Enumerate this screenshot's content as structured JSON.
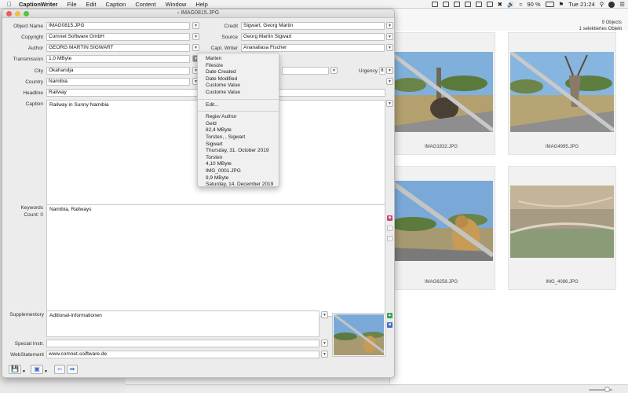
{
  "menubar": {
    "app": "CaptionWriter",
    "items": [
      "File",
      "Edit",
      "Caption",
      "Content",
      "Window",
      "Help"
    ],
    "battery": "90 %",
    "clock": "Tue 21:24"
  },
  "browser": {
    "object_count": "9 Objects",
    "selected": "1 selektiertes Objekt",
    "thumbs": [
      {
        "name": "IMAG1832.JPG"
      },
      {
        "name": "IMAG4995.JPG"
      },
      {
        "name": "IMAG6258.JPG"
      },
      {
        "name": "IMG_4086.JPG"
      }
    ]
  },
  "window": {
    "title": "IMAG0815.JPG",
    "fields": {
      "object_name": {
        "label": "Object Name",
        "value": "IMAG0815.JPG"
      },
      "copyright": {
        "label": "Copyright",
        "value": "Comnet Software GmbH"
      },
      "author": {
        "label": "Author",
        "value": "GEORG MARTIN SIGWART"
      },
      "transmission": {
        "label": "Transmission",
        "value": "1,0 MByte"
      },
      "city": {
        "label": "City",
        "value": "Okahandja"
      },
      "country": {
        "label": "Country",
        "value": "Namibia"
      },
      "headline": {
        "label": "Headline",
        "value": "Railway"
      },
      "caption": {
        "label": "Caption",
        "value": "Railway in Sunny Namibia"
      },
      "credit": {
        "label": "Credit",
        "value": "Sigwart, Georg Martin"
      },
      "source": {
        "label": "Source",
        "value": "Georg Martin Sigwart"
      },
      "capt_writer": {
        "label": "Capt. Writer",
        "value": "Ananaliasa Fischer"
      },
      "urgency": {
        "label": "Urgency",
        "value": "8"
      },
      "keywords": {
        "label": "Keywords",
        "count": "Count: 0",
        "value": "Namibia, Railways"
      },
      "supplementary": {
        "label": "Supplementory",
        "value": "Aditional-Informationen"
      },
      "special_instr": {
        "label": "Special Instr.",
        "value": ""
      },
      "webstatement": {
        "label": "WebStatement",
        "value": "www.comnet-soiftware.de"
      }
    }
  },
  "popup_menu": {
    "group1": [
      "Marten",
      "Filesize",
      "Date Created",
      "Date Modified",
      "Custome Value",
      "Custome Value"
    ],
    "edit": "Edit...",
    "group2": [
      "Regie/ Author",
      "Geld",
      "82,4 MByte",
      "Torsten, , Sigwart",
      "Sigwart",
      "Thursday, 31. October 2019",
      "Torsten",
      "4,10 MByte",
      "IMG_0001.JPG",
      "9,9 MByte",
      "Saturday, 14. December 2019"
    ]
  }
}
